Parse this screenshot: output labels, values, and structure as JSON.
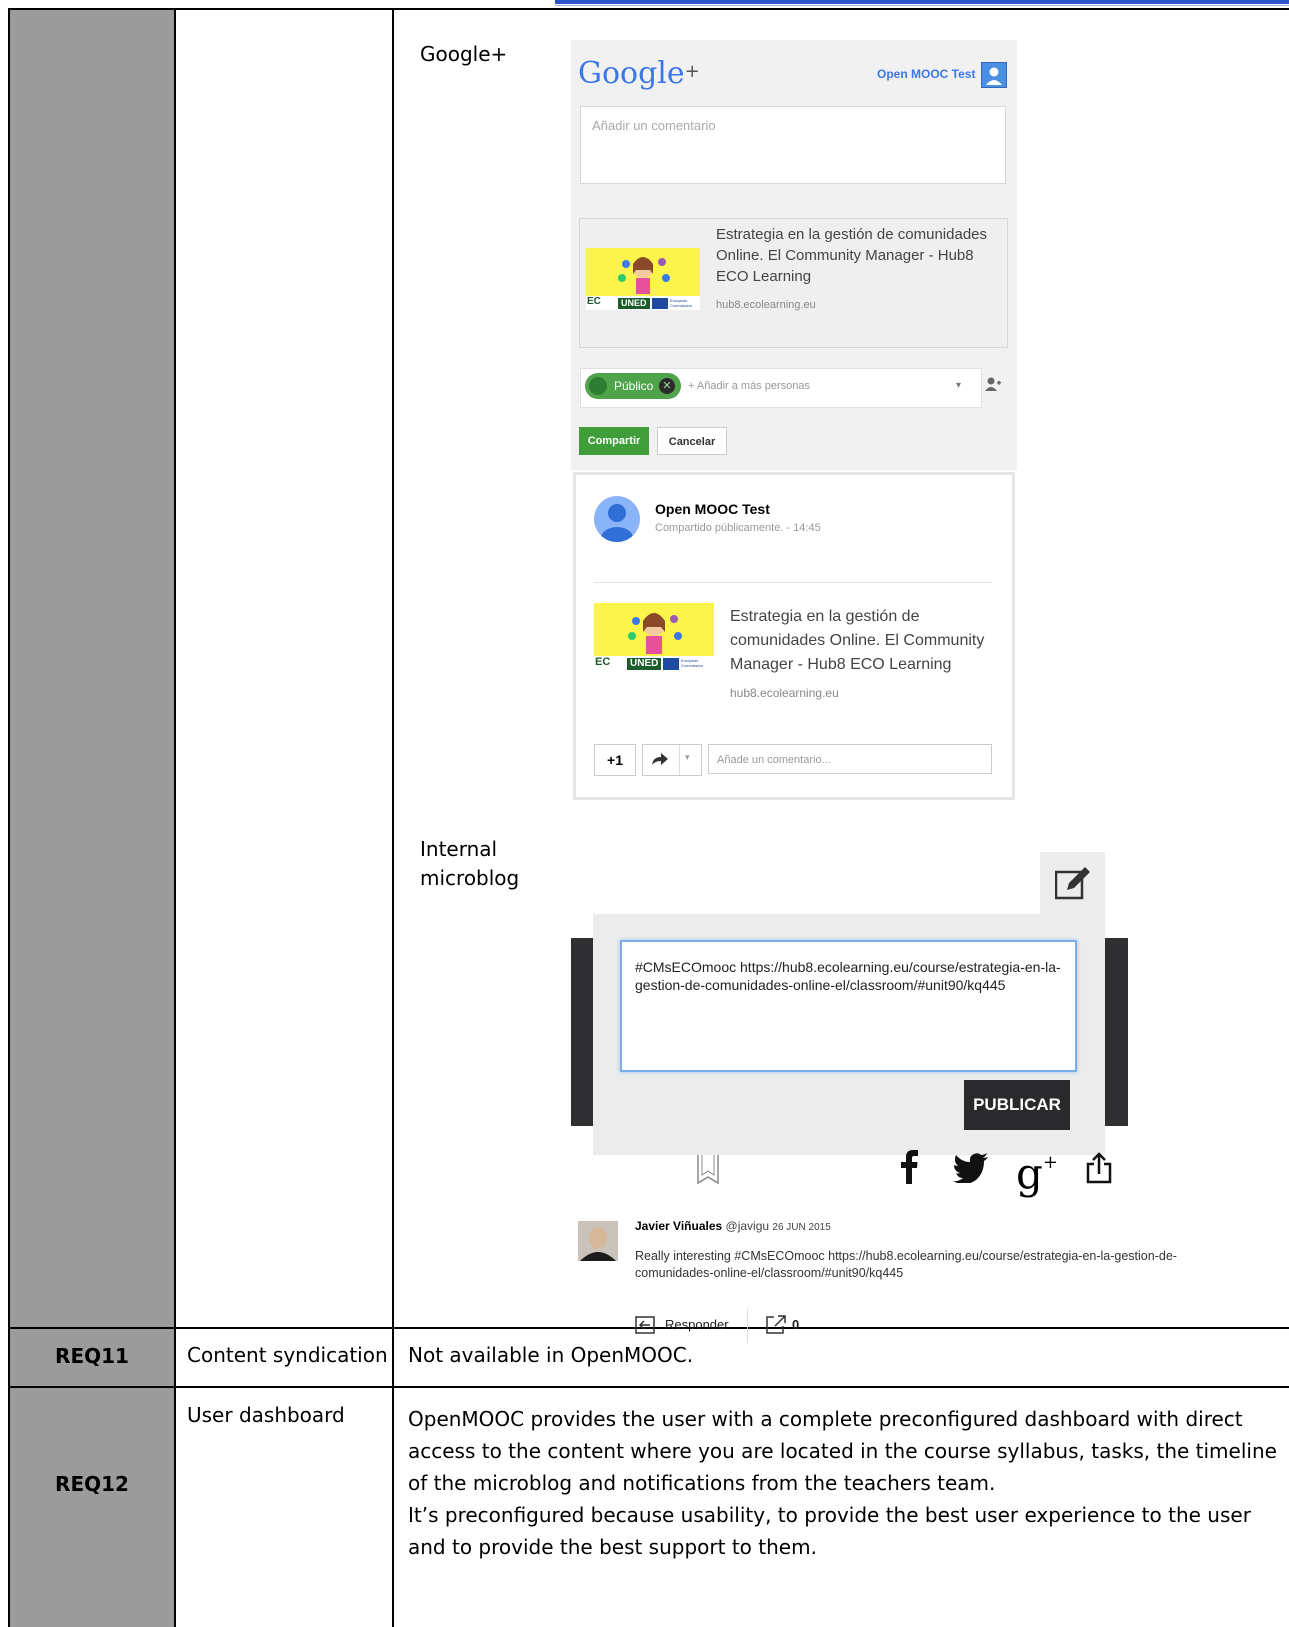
{
  "gplus": {
    "section_label": "Google+",
    "logo": "Google",
    "logo_plus": "+",
    "user_name": "Open MOOC Test",
    "comment_placeholder": "Añadir un comentario",
    "link_title": "Estrategia en la gestión de comunidades Online. El Community Manager - Hub8 ECO Learning",
    "link_url": "hub8.ecolearning.eu",
    "audience_chip": "Público",
    "add_people": "+ Añadir a más personas",
    "share_label": "Compartir",
    "cancel_label": "Cancelar",
    "post_author": "Open MOOC Test",
    "post_meta": "Compartido públicamente.  -  14:45",
    "post_title": "Estrategia en la gestión de comunidades Online. El Community Manager - Hub8 ECO Learning",
    "post_url": "hub8.ecolearning.eu",
    "plus_one": "+1",
    "post_comment_placeholder": "Añade un comentario...",
    "thumb_uned": "UNED",
    "thumb_ec": "EC",
    "thumb_commission": "European Commission"
  },
  "microblog": {
    "section_label_1": "Internal",
    "section_label_2": "microblog",
    "textarea_text": "#CMsECOmooc https://hub8.ecolearning.eu/course/estrategia-en-la-gestion-de-comunidades-online-el/classroom/#unit90/kq445",
    "publish_label": "PUBLICAR",
    "tweet_author": "Javier Viñuales",
    "tweet_handle": "@javigu",
    "tweet_date": "26 JUN 2015",
    "tweet_text": "Really interesting #CMsECOmooc https://hub8.ecolearning.eu/course/estrategia-en-la-gestion-de-comunidades-online-el/classroom/#unit90/kq445",
    "reply_label": "Responder",
    "share_count": "0"
  },
  "rows": [
    {
      "id": "REQ11",
      "name": "Content syndication",
      "description": "Not available in OpenMOOC."
    },
    {
      "id": "REQ12",
      "name": "User dashboard",
      "description_lines": [
        "OpenMOOC provides the user with a complete preconfigured dashboard with direct",
        "access to the content where you are located in the course syllabus, tasks, the timeline",
        "of the microblog and notifications from the teachers team.",
        "It’s preconfigured because usability, to provide the best user experience to the user",
        "and to provide the best support to them."
      ]
    }
  ],
  "colors": {
    "gray_cell": "#9b9b9b",
    "gplus_blue": "#3b78e7",
    "share_green": "#3f9d3a",
    "publish_dark": "#2a2a2c"
  }
}
